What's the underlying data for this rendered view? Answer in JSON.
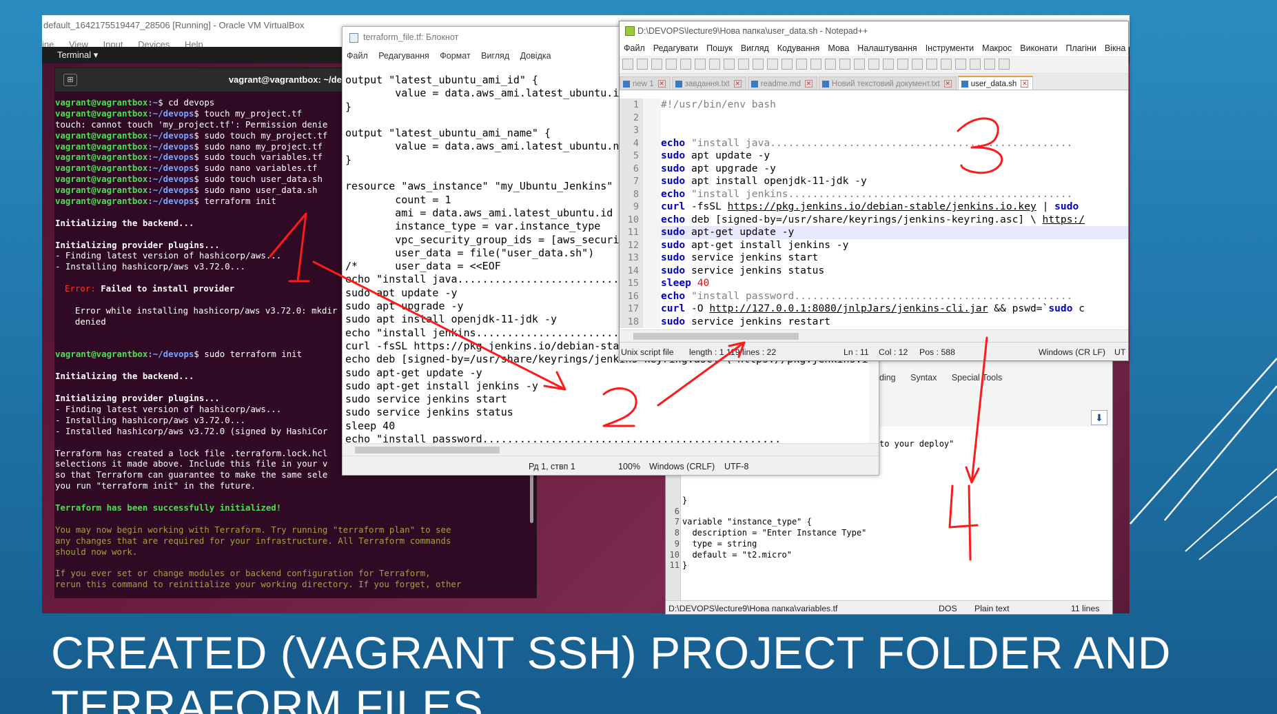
{
  "vbox": {
    "title": "default_1642175519447_28506 [Running] - Oracle VM VirtualBox",
    "menu": [
      "ine",
      "View",
      "Input",
      "Devices",
      "Help"
    ],
    "activities": "Terminal ▾"
  },
  "terminal": {
    "title": "vagrant@vagrantbox: ~/devops",
    "prompt_user": "vagrant@vagrantbox",
    "lines": [
      {
        "host": "vagrant@vagrantbox",
        "path": ":~",
        "cmd": "$ cd devops"
      },
      {
        "host": "vagrant@vagrantbox",
        "path": ":~/devops",
        "cmd": "$ touch my_project.tf"
      },
      {
        "text": "touch: cannot touch 'my_project.tf': Permission denie"
      },
      {
        "host": "vagrant@vagrantbox",
        "path": ":~/devops",
        "cmd": "$ sudo touch my_project.tf"
      },
      {
        "host": "vagrant@vagrantbox",
        "path": ":~/devops",
        "cmd": "$ sudo nano my_project.tf"
      },
      {
        "host": "vagrant@vagrantbox",
        "path": ":~/devops",
        "cmd": "$ sudo touch variables.tf"
      },
      {
        "host": "vagrant@vagrantbox",
        "path": ":~/devops",
        "cmd": "$ sudo nano variables.tf"
      },
      {
        "host": "vagrant@vagrantbox",
        "path": ":~/devops",
        "cmd": "$ sudo touch user_data.sh"
      },
      {
        "host": "vagrant@vagrantbox",
        "path": ":~/devops",
        "cmd": "$ sudo nano user_data.sh"
      },
      {
        "host": "vagrant@vagrantbox",
        "path": ":~/devops",
        "cmd": "$ terraform init"
      },
      {
        "text": ""
      },
      {
        "bold": "Initializing the backend..."
      },
      {
        "text": ""
      },
      {
        "bold": "Initializing provider plugins..."
      },
      {
        "text": "- Finding latest version of hashicorp/aws..."
      },
      {
        "text": "- Installing hashicorp/aws v3.72.0..."
      },
      {
        "text": ""
      },
      {
        "err": "Error: ",
        "bold": "Failed to install provider",
        "indent": true
      },
      {
        "text": ""
      },
      {
        "text": "  Error while installing hashicorp/aws v3.72.0: mkdir",
        "indent": true
      },
      {
        "text": "  denied",
        "indent": true
      },
      {
        "text": ""
      },
      {
        "text": ""
      },
      {
        "host": "vagrant@vagrantbox",
        "path": ":~/devops",
        "cmd": "$ sudo terraform init"
      },
      {
        "text": ""
      },
      {
        "bold": "Initializing the backend..."
      },
      {
        "text": ""
      },
      {
        "bold": "Initializing provider plugins..."
      },
      {
        "text": "- Finding latest version of hashicorp/aws..."
      },
      {
        "text": "- Installing hashicorp/aws v3.72.0..."
      },
      {
        "text": "- Installed hashicorp/aws v3.72.0 (signed by HashiCor"
      },
      {
        "text": ""
      },
      {
        "text": "Terraform has created a lock file .terraform.lock.hcl"
      },
      {
        "text": "selections it made above. Include this file in your v"
      },
      {
        "text": "so that Terraform can guarantee to make the same sele"
      },
      {
        "text": "you run \"terraform init\" in the future."
      },
      {
        "text": ""
      },
      {
        "green": "Terraform has been successfully initialized!"
      },
      {
        "text": ""
      },
      {
        "olive": "You may now begin working with Terraform. Try running \"terraform plan\" to see"
      },
      {
        "olive": "any changes that are required for your infrastructure. All Terraform commands"
      },
      {
        "olive": "should now work."
      },
      {
        "text": ""
      },
      {
        "olive": "If you ever set or change modules or backend configuration for Terraform,"
      },
      {
        "olive": "rerun this command to reinitialize your working directory. If you forget, other"
      }
    ]
  },
  "notepad": {
    "title": "terraform_file.tf: Блокнот",
    "menu": [
      "Файл",
      "Редагування",
      "Формат",
      "Вигляд",
      "Довідка"
    ],
    "lines": [
      "output \"latest_ubuntu_ami_id\" {",
      "        value = data.aws_ami.latest_ubuntu.id",
      "}",
      "",
      "output \"latest_ubuntu_ami_name\" {",
      "        value = data.aws_ami.latest_ubuntu.nar",
      "}",
      "",
      "resource \"aws_instance\" \"my_Ubuntu_Jenkins\" {",
      "        count = 1",
      "        ami = data.aws_ami.latest_ubuntu.id",
      "        instance_type = var.instance_type",
      "        vpc_security_group_ids = [aws_security",
      "        user_data = file(\"user_data.sh\")",
      "/*      user_data = <<EOF",
      "echo \"install java...............................",
      "sudo apt update -y",
      "sudo apt upgrade -y",
      "sudo apt install openjdk-11-jdk -y",
      "echo \"install jenkins............................",
      "curl -fsSL https://pkg.jenkins.io/debian-stab",
      "echo deb [signed-by=/usr/share/keyrings/jenkins-keyring.asc] \\ https://pkg.jenkins.io/",
      "sudo apt-get update -y",
      "sudo apt-get install jenkins -y",
      "sudo service jenkins start",
      "sudo service jenkins status",
      "sleep 40",
      "echo \"install password................................................"
    ],
    "status": {
      "pos": "Рд 1, ствп 1",
      "zoom": "100%",
      "eol": "Windows (CRLF)",
      "enc": "UTF-8"
    }
  },
  "npp": {
    "title": "D:\\DEVOPS\\lecture9\\Нова папка\\user_data.sh - Notepad++",
    "menu": [
      "Файл",
      "Редагувати",
      "Пошук",
      "Вигляд",
      "Кодування",
      "Мова",
      "Налаштування",
      "Інструменти",
      "Макрос",
      "Виконати",
      "Плагіни",
      "Вікна"
    ],
    "tabs": [
      {
        "label": "new 1",
        "active": false
      },
      {
        "label": "завдання.txt",
        "active": false
      },
      {
        "label": "readme.md",
        "active": false
      },
      {
        "label": "Новий текстовий документ.txt",
        "active": false
      },
      {
        "label": "user_data.sh",
        "active": true
      }
    ],
    "lines": [
      {
        "n": "1",
        "html": [
          [
            "cm",
            "#!/usr/bin/env bash"
          ]
        ]
      },
      {
        "n": "2",
        "html": []
      },
      {
        "n": "3",
        "html": []
      },
      {
        "n": "4",
        "html": [
          [
            "kw",
            "echo"
          ],
          [
            "str",
            " \"install java.................................................."
          ]
        ]
      },
      {
        "n": "5",
        "html": [
          [
            "kw",
            "sudo"
          ],
          [
            "",
            " apt update -y"
          ]
        ]
      },
      {
        "n": "6",
        "html": [
          [
            "kw",
            "sudo"
          ],
          [
            "",
            " apt upgrade -y"
          ]
        ]
      },
      {
        "n": "7",
        "html": [
          [
            "kw",
            "sudo"
          ],
          [
            "",
            " apt install openjdk-11-jdk -y"
          ]
        ]
      },
      {
        "n": "8",
        "html": [
          [
            "kw",
            "echo"
          ],
          [
            "str",
            " \"install jenkins..............................................."
          ]
        ]
      },
      {
        "n": "9",
        "html": [
          [
            "kw",
            "curl"
          ],
          [
            "",
            " -fsSL "
          ],
          [
            "url",
            "https://pkg.jenkins.io/debian-stable/jenkins.io.key"
          ],
          [
            "",
            " | "
          ],
          [
            "kw",
            "sudo"
          ]
        ]
      },
      {
        "n": "10",
        "html": [
          [
            "kw",
            "echo"
          ],
          [
            "",
            " deb [signed-by=/usr/share/keyrings/jenkins-keyring.asc] \\ "
          ],
          [
            "url",
            "https:/"
          ]
        ]
      },
      {
        "n": "11",
        "html": [
          [
            "kw",
            "sudo"
          ],
          [
            "",
            " apt-get update -y"
          ]
        ],
        "current": true
      },
      {
        "n": "12",
        "html": [
          [
            "kw",
            "sudo"
          ],
          [
            "",
            " apt-get install jenkins -y"
          ]
        ]
      },
      {
        "n": "13",
        "html": [
          [
            "kw",
            "sudo"
          ],
          [
            "",
            " service jenkins start"
          ]
        ]
      },
      {
        "n": "14",
        "html": [
          [
            "kw",
            "sudo"
          ],
          [
            "",
            " service jenkins status"
          ]
        ]
      },
      {
        "n": "15",
        "html": [
          [
            "kw",
            "sleep"
          ],
          [
            "numc",
            " 40"
          ]
        ]
      },
      {
        "n": "16",
        "html": [
          [
            "kw",
            "echo"
          ],
          [
            "str",
            " \"install password.............................................."
          ]
        ]
      },
      {
        "n": "17",
        "html": [
          [
            "kw",
            "curl"
          ],
          [
            "",
            " -O "
          ],
          [
            "url",
            "http://127.0.0.1:8080/jnlpJars/jenkins-cli.jar"
          ],
          [
            "",
            " && pswd=`"
          ],
          [
            "kw",
            "sudo"
          ],
          [
            "",
            " c"
          ]
        ]
      },
      {
        "n": "18",
        "html": [
          [
            "kw",
            "sudo"
          ],
          [
            "",
            " service jenkins restart"
          ]
        ]
      }
    ],
    "status": {
      "type": "Unix script file",
      "length": "length : 1 119",
      "lines": "lines : 22",
      "ln": "Ln : 11",
      "col": "Col : 12",
      "pos": "Pos : 588",
      "eol": "Windows (CR LF)",
      "enc": "UT"
    }
  },
  "npp2": {
    "menu_partial": [
      "ding",
      "Syntax",
      "Special Tools"
    ],
    "deploy_text": "to your deploy\"",
    "lines": [
      {
        "n": "",
        "t": "}"
      },
      {
        "n": "6",
        "t": ""
      },
      {
        "n": "7",
        "t": "variable \"instance_type\" {"
      },
      {
        "n": "8",
        "t": "  description = \"Enter Instance Type\""
      },
      {
        "n": "9",
        "t": "  type = string"
      },
      {
        "n": "10",
        "t": "  default = \"t2.micro\""
      },
      {
        "n": "11",
        "t": "}"
      }
    ],
    "status": {
      "path": "D:\\DEVOPS\\lecture9\\Нова папка\\variables.tf",
      "eol": "DOS",
      "type": "Plain text",
      "lines": "11 lines"
    }
  },
  "slide": {
    "title_line1": "CREATED (VAGRANT SSH)  PROJECT FOLDER AND",
    "title_line2": "TERRAFORM FILES"
  },
  "annotations": [
    "1",
    "2",
    "3",
    "4"
  ],
  "colors": {
    "slide_bg": "#1f72a6",
    "terminal_bg": "#300a24",
    "prompt_green": "#4ce14c",
    "prompt_blue": "#7aa6ff",
    "annotation_red": "#ff1a1a",
    "npp_keyword": "#0000c0"
  }
}
